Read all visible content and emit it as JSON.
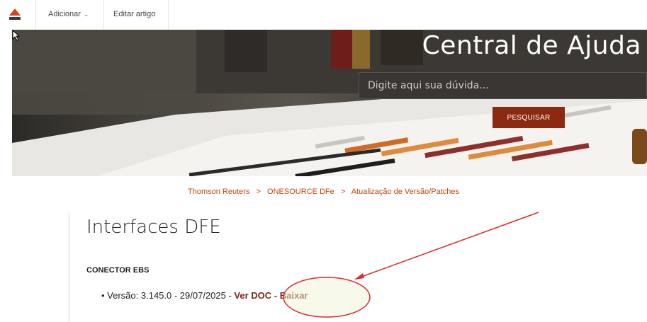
{
  "topnav": {
    "add_label": "Adicionar",
    "edit_label": "Editar artigo"
  },
  "hero": {
    "title": "Central de Ajuda",
    "search_placeholder": "Digite aqui sua dúvida...",
    "search_button": "PESQUISAR"
  },
  "breadcrumb": {
    "items": [
      "Thomson Reuters",
      "ONESOURCE DFe",
      "Atualização de Versão/Patches"
    ],
    "separator": ">"
  },
  "article": {
    "title": "Interfaces DFE",
    "section": "CONECTOR EBS",
    "entry_prefix": "Versão: 3.145.0 - 29/07/2025 - ",
    "doc_link": "Ver DOC",
    "dash": " - ",
    "download_link": "Baixar"
  },
  "colors": {
    "accent": "#c1440e",
    "button": "#8b2a10",
    "link": "#7a2a12",
    "annotation": "#e0282e"
  }
}
